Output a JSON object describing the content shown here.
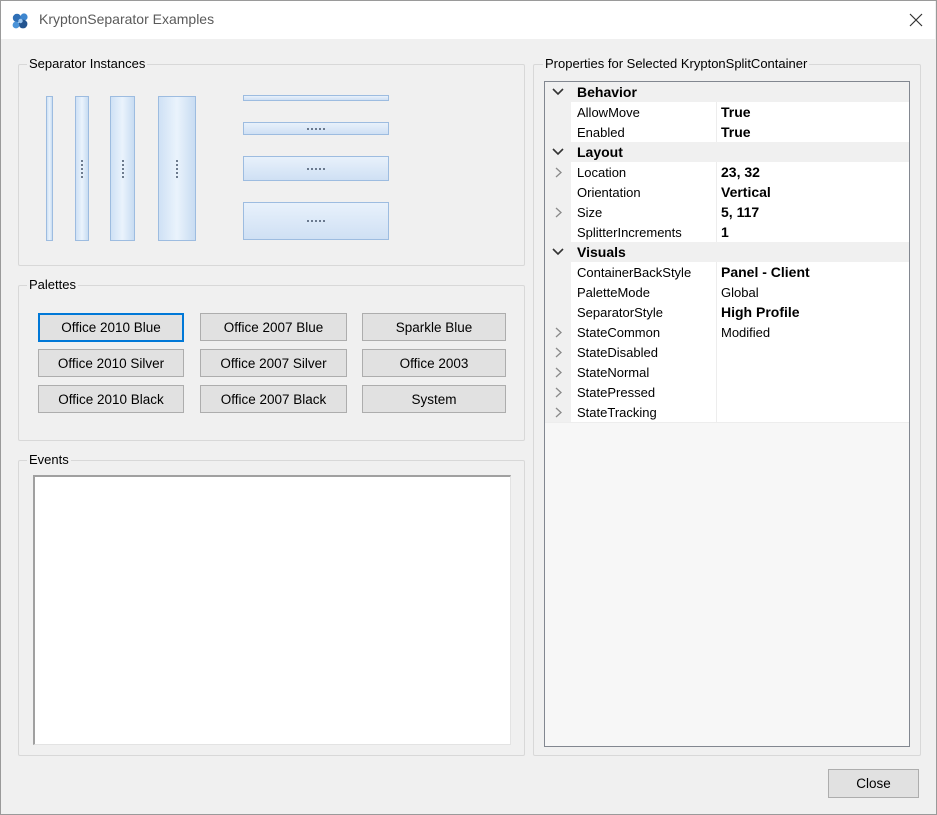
{
  "window": {
    "title": "KryptonSeparator Examples",
    "accent": "#0078d7"
  },
  "separators": {
    "label": "Separator Instances"
  },
  "palettes": {
    "label": "Palettes",
    "buttons": [
      "Office 2010 Blue",
      "Office 2007 Blue",
      "Sparkle Blue",
      "Office 2010 Silver",
      "Office 2007 Silver",
      "Office 2003",
      "Office 2010 Black",
      "Office 2007 Black",
      "System"
    ]
  },
  "events": {
    "label": "Events"
  },
  "properties": {
    "label": "Properties for Selected KryptonSplitContainer",
    "rows": [
      {
        "type": "category",
        "name": "Behavior"
      },
      {
        "type": "prop",
        "name": "AllowMove",
        "value": "True",
        "bold": true,
        "expandable": false
      },
      {
        "type": "prop",
        "name": "Enabled",
        "value": "True",
        "bold": true,
        "expandable": false
      },
      {
        "type": "category",
        "name": "Layout"
      },
      {
        "type": "prop",
        "name": "Location",
        "value": "23, 32",
        "bold": true,
        "expandable": true
      },
      {
        "type": "prop",
        "name": "Orientation",
        "value": "Vertical",
        "bold": true,
        "expandable": false
      },
      {
        "type": "prop",
        "name": "Size",
        "value": "5, 117",
        "bold": true,
        "expandable": true
      },
      {
        "type": "prop",
        "name": "SplitterIncrements",
        "value": "1",
        "bold": true,
        "expandable": false
      },
      {
        "type": "category",
        "name": "Visuals"
      },
      {
        "type": "prop",
        "name": "ContainerBackStyle",
        "value": "Panel - Client",
        "bold": true,
        "expandable": false
      },
      {
        "type": "prop",
        "name": "PaletteMode",
        "value": "Global",
        "bold": false,
        "expandable": false
      },
      {
        "type": "prop",
        "name": "SeparatorStyle",
        "value": "High Profile",
        "bold": true,
        "expandable": false
      },
      {
        "type": "prop",
        "name": "StateCommon",
        "value": "Modified",
        "bold": false,
        "expandable": true
      },
      {
        "type": "prop",
        "name": "StateDisabled",
        "value": "",
        "bold": false,
        "expandable": true
      },
      {
        "type": "prop",
        "name": "StateNormal",
        "value": "",
        "bold": false,
        "expandable": true
      },
      {
        "type": "prop",
        "name": "StatePressed",
        "value": "",
        "bold": false,
        "expandable": true
      },
      {
        "type": "prop",
        "name": "StateTracking",
        "value": "",
        "bold": false,
        "expandable": true
      }
    ]
  },
  "close_button": "Close"
}
